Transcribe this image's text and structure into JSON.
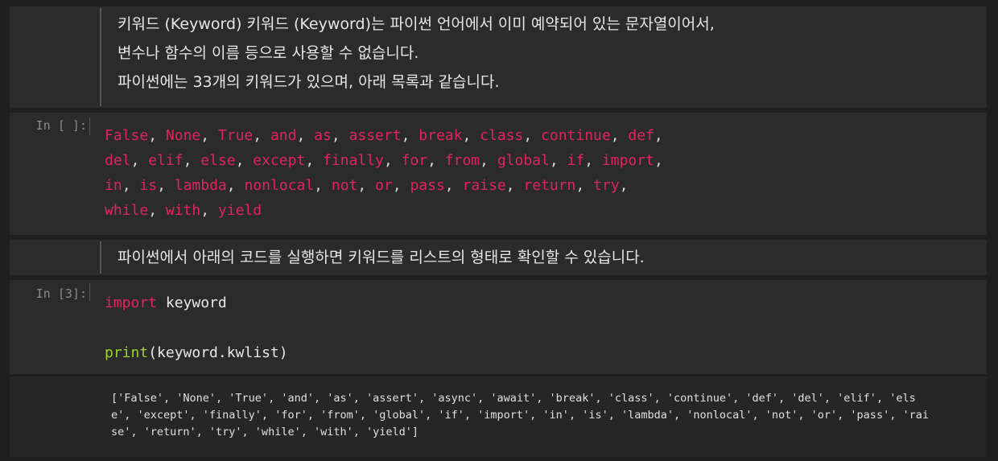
{
  "md1": {
    "lines": [
      "키워드 (Keyword) 키워드 (Keyword)는 파이썬 언어에서 이미 예약되어 있는 문자열이어서,",
      "변수나 함수의 이름 등으로 사용할 수 없습니다.",
      "파이썬에는 33개의 키워드가 있으며, 아래 목록과 같습니다."
    ]
  },
  "code1": {
    "prompt": "In [ ]:",
    "lines": [
      [
        "False",
        "None",
        "True",
        "and",
        "as",
        "assert",
        "break",
        "class",
        "continue",
        "def"
      ],
      [
        "del",
        "elif",
        "else",
        "except",
        "finally",
        "for",
        "from",
        "global",
        "if",
        "import"
      ],
      [
        "in",
        "is",
        "lambda",
        "nonlocal",
        "not",
        "or",
        "pass",
        "raise",
        "return",
        "try"
      ],
      [
        "while",
        "with",
        "yield"
      ]
    ]
  },
  "md2": {
    "line": "파이썬에서 아래의 코드를 실행하면 키워드를 리스트의 형태로 확인할 수 있습니다."
  },
  "code2": {
    "prompt": "In [3]:",
    "import_kw": "import",
    "module": "keyword",
    "print_fn": "print",
    "print_arg": "(keyword.kwlist)"
  },
  "output": {
    "lines": [
      "['False', 'None', 'True', 'and', 'as', 'assert', 'async', 'await', 'break', 'class', 'continue', 'def', 'del', 'elif', 'els",
      "e', 'except', 'finally', 'for', 'from', 'global', 'if', 'import', 'in', 'is', 'lambda', 'nonlocal', 'not', 'or', 'pass', 'rai",
      "se', 'return', 'try', 'while', 'with', 'yield']"
    ]
  },
  "colors": {
    "keyword": "#e0245e",
    "builtin": "#9dd12f",
    "background": "#1f1f1f",
    "cell": "#2b2b2b"
  }
}
